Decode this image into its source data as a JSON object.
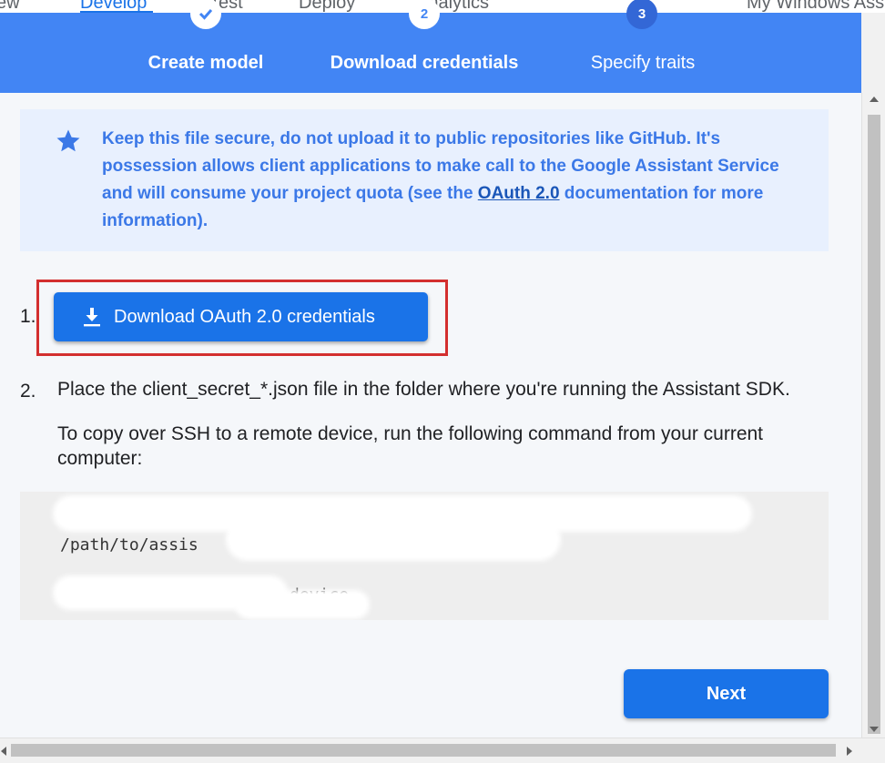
{
  "top_nav": {
    "items": [
      "ew",
      "Develop",
      "Test",
      "Deploy",
      "Analytics",
      "My Windows Ass"
    ]
  },
  "stepper": {
    "steps": [
      {
        "number": "",
        "label": "Create model",
        "state": "done"
      },
      {
        "number": "2",
        "label": "Download credentials",
        "state": "current"
      },
      {
        "number": "3",
        "label": "Specify traits",
        "state": "pending"
      }
    ]
  },
  "info_banner": {
    "icon": "star-icon",
    "text_before_link": "Keep this file secure, do not upload it to public repositories like GitHub. It's possession allows client applications to make call to the Google Assistant Service and will consume your project quota (see the ",
    "link_text": "OAuth 2.0",
    "text_after_link": " documentation for more information)."
  },
  "step1": {
    "number": "1.",
    "button_label": "Download OAuth 2.0 credentials",
    "button_icon": "download-icon"
  },
  "step2": {
    "number": "2.",
    "instruction": "Place the client_secret_*.json file in the folder where you're running the Assistant SDK.",
    "ssh_note": "To copy over SSH to a remote device, run the following command from your current computer:",
    "code_lines": [
      "/path/to/assis",
      "device"
    ]
  },
  "footer": {
    "next_label": "Next"
  },
  "colors": {
    "header_blue": "#4285f4",
    "button_blue": "#1a73e8",
    "banner_bg": "#e8f0fe",
    "highlight_red": "#d32f2f"
  }
}
